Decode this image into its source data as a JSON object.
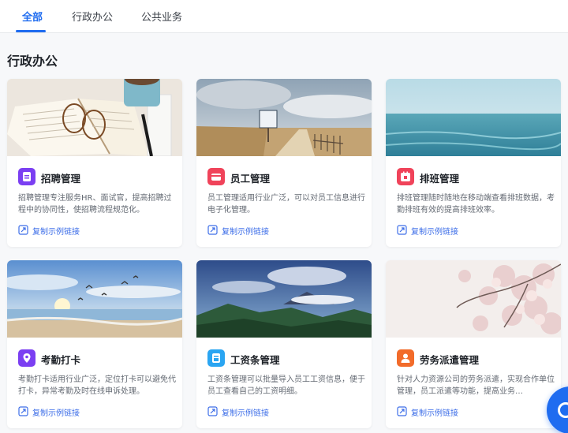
{
  "tabs": [
    {
      "label": "全部",
      "active": true
    },
    {
      "label": "行政办公",
      "active": false
    },
    {
      "label": "公共业务",
      "active": false
    }
  ],
  "section_title": "行政办公",
  "link_label": "复制示例链接",
  "cards": [
    {
      "title": "招聘管理",
      "desc": "招聘管理专注服务HR、面试官，提高招聘过程中的协同性，使招聘流程规范化。",
      "icon": "recruit-doc-icon",
      "icon_color": "#7b3ff2",
      "image": "open-book-with-glasses-and-coffee"
    },
    {
      "title": "员工管理",
      "desc": "员工管理适用行业广泛，可以对员工信息进行电子化管理。",
      "icon": "employee-card-icon",
      "icon_color": "#f0435a",
      "image": "beach-path-with-sign"
    },
    {
      "title": "排班管理",
      "desc": "排班管理随时随地在移动端查看排班数据，考勤排班有效的提高排班效率。",
      "icon": "calendar-icon",
      "icon_color": "#f0435a",
      "image": "calm-sea"
    },
    {
      "title": "考勤打卡",
      "desc": "考勤打卡适用行业广泛，定位打卡可以避免代打卡，异常考勤及时在线申诉处理。",
      "icon": "location-pin-icon",
      "icon_color": "#7b3ff2",
      "image": "seaside-sunset-with-birds"
    },
    {
      "title": "工资条管理",
      "desc": "工资条管理可以批量导入员工工资信息，便于员工查看自己的工资明细。",
      "icon": "payslip-icon",
      "icon_color": "#2aa5f2",
      "image": "volcano-landscape"
    },
    {
      "title": "劳务派遣管理",
      "desc": "针对人力资源公司的劳务派遣，实现合作单位管理，员工派遣等功能，提高业务…",
      "icon": "person-icon",
      "icon_color": "#f26b2a",
      "image": "cherry-blossoms"
    }
  ],
  "accent_color": "#1f6cf0"
}
